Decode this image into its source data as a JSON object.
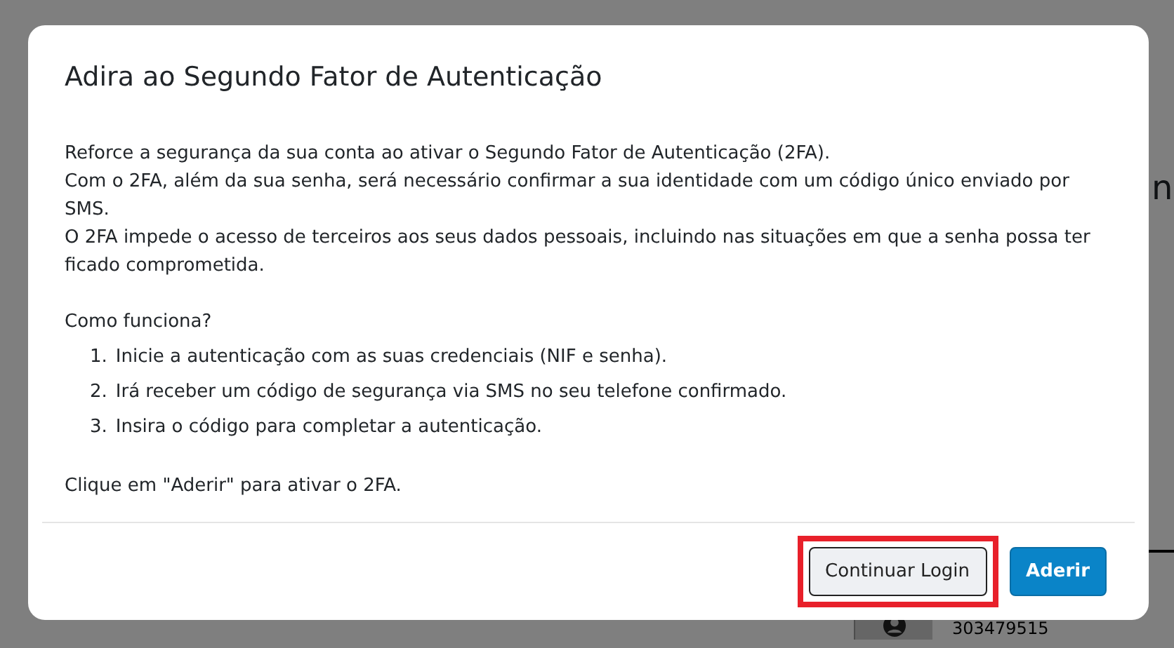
{
  "background": {
    "heading_fragment": "n",
    "table": {
      "cell": "303479515"
    }
  },
  "dialog": {
    "title": "Adira ao Segundo Fator de Autenticação",
    "paragraphs": [
      "Reforce a segurança da sua conta ao ativar o Segundo Fator de Autenticação (2FA).",
      "Com o 2FA, além da sua senha, será necessário confirmar a sua identidade com um código único enviado por SMS.",
      "O 2FA impede o acesso de terceiros aos seus dados pessoais, incluindo nas situações em que a senha possa ter ficado comprometida."
    ],
    "how_it_works": {
      "heading": "Como funciona?",
      "steps": [
        {
          "number": "1.",
          "text": "Inicie a autenticação com as suas credenciais (NIF e senha)."
        },
        {
          "number": "2.",
          "text": "Irá receber um código de segurança via SMS no seu telefone confirmado."
        },
        {
          "number": "3.",
          "text": "Insira o código para completar a autenticação."
        }
      ]
    },
    "closing": "Clique em \"Aderir\" para ativar o 2FA.",
    "buttons": [
      {
        "label": "Continuar Login",
        "kind": "secondary",
        "highlighted": true
      },
      {
        "label": "Aderir",
        "kind": "primary",
        "highlighted": false
      }
    ]
  }
}
